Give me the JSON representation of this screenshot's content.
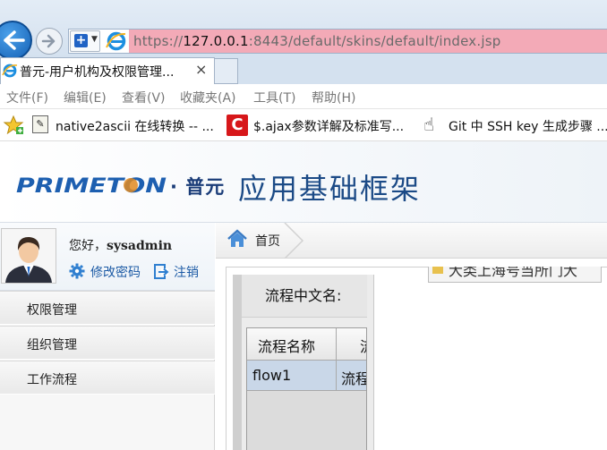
{
  "browser": {
    "url_prefix": "https://",
    "url_host": "127.0.0.1",
    "url_rest": ":8443/default/skins/default/index.jsp",
    "tab_title": "普元-用户机构及权限管理...",
    "tab_close": "×",
    "menu": [
      "文件(F)",
      "编辑(E)",
      "查看(V)",
      "收藏夹(A)",
      "工具(T)",
      "帮助(H)"
    ],
    "favorites": [
      {
        "label": "native2ascii 在线转换 -- ...",
        "icon": "page-icon"
      },
      {
        "label": "$.ajax参数详解及标准写...",
        "icon": "c-logo-icon"
      },
      {
        "label": "Git 中 SSH key 生成步骤 ...",
        "icon": "cursor-logo-icon"
      }
    ]
  },
  "header": {
    "logo_text": "PRIMETON",
    "brand_cn": "· 普元",
    "app_title": "应用基础框架"
  },
  "user": {
    "greeting": "您好，",
    "username": "sysadmin",
    "change_password": "修改密码",
    "logout": "注销"
  },
  "sidebar": {
    "items": [
      {
        "label": "权限管理"
      },
      {
        "label": "组织管理"
      },
      {
        "label": "工作流程"
      }
    ]
  },
  "main": {
    "home_tab": "首页",
    "search_label": "流程中文名:",
    "grid_headers": [
      "流程名称",
      "流"
    ],
    "grid_rows": [
      [
        "flow1",
        "流程"
      ]
    ],
    "top_button": "大类上海号当所门大"
  },
  "colors": {
    "accent": "#1c5aa5",
    "url_highlight": "#f3aab7",
    "title_blue": "#1b4a86",
    "selected_row": "#c9d7e8"
  }
}
